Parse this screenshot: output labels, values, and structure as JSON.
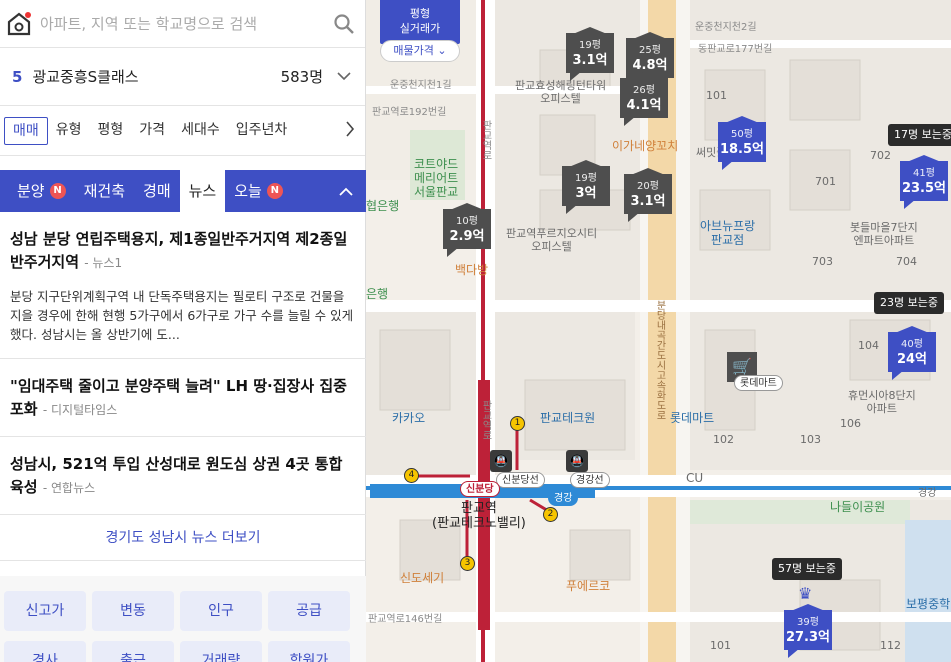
{
  "search": {
    "placeholder": "아파트, 지역 또는 학교명으로 검색"
  },
  "complex": {
    "number": "5",
    "name": "광교중흥S클래스",
    "count": "583명"
  },
  "filters": [
    "매매",
    "유형",
    "평형",
    "가격",
    "세대수",
    "입주년차"
  ],
  "tabs": [
    {
      "label": "분양",
      "badge": "N"
    },
    {
      "label": "재건축"
    },
    {
      "label": "경매"
    },
    {
      "label": "뉴스"
    },
    {
      "label": "오늘",
      "badge": "N"
    }
  ],
  "news": [
    {
      "title": "성남 분당 연립주택용지, 제1종일반주거지역 제2종일반주거지역",
      "source": "- 뉴스1",
      "body": "분당 지구단위계획구역 내 단독주택용지는 필로티 구조로 건물을 지을 경우에 한해 현행 5가구에서 6가구로 가구 수를 늘릴 수 있게 했다. 성남시는 올 상반기에 도..."
    },
    {
      "title": "\"임대주택 줄이고 분양주택 늘려\" LH 땅·집장사 집중포화",
      "source": "- 디지털타임스"
    },
    {
      "title": "성남시, 521억 투입 산성대로 원도심 상권 4곳 통합 육성",
      "source": "- 연합뉴스"
    }
  ],
  "news_more": "경기도 성남시 뉴스 더보기",
  "categories": [
    "신고가",
    "변동",
    "인구",
    "공급",
    "경사",
    "출근",
    "거래량",
    "학원가"
  ],
  "price_chip": {
    "title": "평형\n실거래가",
    "select": "매물가격"
  },
  "markers": [
    {
      "area": "19평",
      "price": "3.1억",
      "style": "gray"
    },
    {
      "area": "25평",
      "price": "4.8억",
      "style": "gray"
    },
    {
      "area": "26평",
      "price": "4.1억",
      "style": "gray"
    },
    {
      "area": "50평",
      "price": "18.5억",
      "style": "blue"
    },
    {
      "area": "41평",
      "price": "23.5억",
      "style": "blue"
    },
    {
      "area": "19평",
      "price": "3억",
      "style": "gray"
    },
    {
      "area": "20평",
      "price": "3.1억",
      "style": "gray"
    },
    {
      "area": "10평",
      "price": "2.9억",
      "style": "gray"
    },
    {
      "area": "40평",
      "price": "24억",
      "style": "blue"
    },
    {
      "area": "39평",
      "price": "27.3억",
      "style": "blue"
    }
  ],
  "viewers": [
    "17명 보는중",
    "23명 보는중",
    "57명 보는중"
  ],
  "map_labels": {
    "road1": "운중천지천2길",
    "road2": "동판교로177번길",
    "road3": "운중천지천1길",
    "road4": "판교역로192번길",
    "road5": "판교역로146번길",
    "bldg1": "판교효성해링턴타워\n오피스텔",
    "bldg2": "코트야드\n메리어트\n서울판교",
    "bldg3": "판교역푸르지오시티\n오피스텔",
    "bldg4": "이가네양꼬치",
    "bldg5": "써밋플레",
    "bldg6": "아브뉴프랑\n판교점",
    "bldg7": "봇들마을7단지\n엔파트아파트",
    "bldg8": "휴먼시아8단지\n아파트",
    "bldg9": "롯데마트",
    "bldg10": "판교테크원",
    "bldg11": "카카오",
    "bldg12": "판교역\n(판교테크노밸리)",
    "bldg13": "신도세기",
    "bldg14": "푸에르코",
    "bldg15": "나들이공원",
    "bldg16": "보평중학",
    "bldg17": "백다방",
    "bldg18": "협은행",
    "bldg19": "은행",
    "mart_label": "롯데마트",
    "cu": "CU",
    "st1": "신분당선",
    "st2": "경강선",
    "st3": "신분당",
    "st4": "경강",
    "st_edge": "경강",
    "n701": "701",
    "n702": "702",
    "n703": "703",
    "n704": "704",
    "n101": "101",
    "n102": "102",
    "n103": "103",
    "n104": "104",
    "n106": "106",
    "n112": "112",
    "n101b": "101",
    "vroad1": "운중천지천2길",
    "vroad2": "판교역로",
    "vroad3": "분당내곡간도시고속화도로",
    "vroad4": "판교역로"
  }
}
